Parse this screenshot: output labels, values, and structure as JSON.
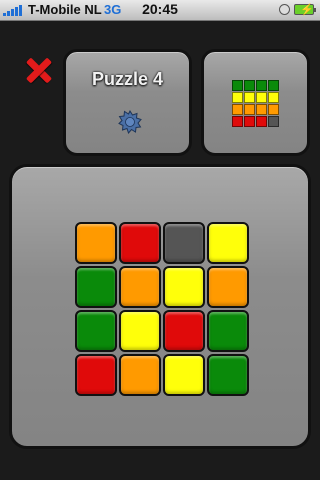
{
  "statusbar": {
    "carrier": "T-Mobile NL",
    "network": "3G",
    "time": "20:45"
  },
  "header": {
    "puzzle_title": "Puzzle 4"
  },
  "colors": {
    "orange": "#ff9a00",
    "red": "#e00a0a",
    "green": "#0a8a0a",
    "yellow": "#ffff0a",
    "empty": "#555555",
    "close": "#e21b1b",
    "badge": "#4a6fa5"
  },
  "icons": {
    "close": "close-icon",
    "badge": "gear-badge-icon"
  },
  "preview": {
    "rows": [
      [
        "green",
        "green",
        "green",
        "green"
      ],
      [
        "yellow",
        "yellow",
        "yellow",
        "yellow"
      ],
      [
        "orange",
        "orange",
        "orange",
        "orange"
      ],
      [
        "red",
        "red",
        "red",
        "empty"
      ]
    ]
  },
  "board": {
    "rows": [
      [
        "orange",
        "red",
        "empty",
        "yellow"
      ],
      [
        "green",
        "orange",
        "yellow",
        "orange"
      ],
      [
        "green",
        "yellow",
        "red",
        "green"
      ],
      [
        "red",
        "orange",
        "yellow",
        "green"
      ]
    ]
  }
}
